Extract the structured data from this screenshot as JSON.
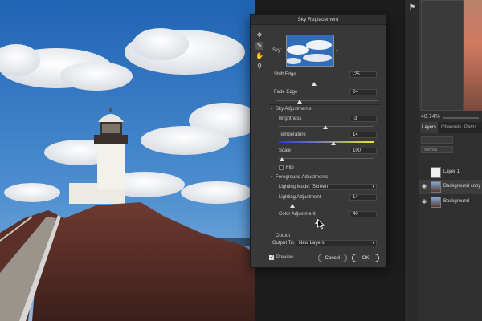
{
  "dialog": {
    "title": "Sky Replacement",
    "sky_label": "Sky:",
    "shift_edge": {
      "label": "Shift Edge",
      "value": "-25",
      "level": 0.38
    },
    "fade_edge": {
      "label": "Fade Edge",
      "value": "24",
      "level": 0.24
    },
    "sky_adjustments": {
      "heading": "Sky Adjustments",
      "brightness": {
        "label": "Brightness",
        "value": "-3",
        "level": 0.49
      },
      "temperature": {
        "label": "Temperature",
        "value": "14",
        "level": 0.57
      },
      "scale": {
        "label": "Scale",
        "value": "100",
        "level": 0.03
      },
      "flip_label": "Flip"
    },
    "foreground_adjustments": {
      "heading": "Foreground Adjustments",
      "lighting_mode_label": "Lighting Mode:",
      "lighting_mode_value": "Screen",
      "lighting_adjustment": {
        "label": "Lighting Adjustment",
        "value": "14",
        "level": 0.14
      },
      "color_adjustment": {
        "label": "Color Adjustment",
        "value": "40",
        "level": 0.4
      }
    },
    "output": {
      "heading": "Output",
      "output_to_label": "Output To:",
      "output_to_value": "New Layers"
    },
    "preview_label": "Preview",
    "cancel_label": "Cancel",
    "ok_label": "OK"
  },
  "right_panel": {
    "zoom": "48.74%",
    "tabs": [
      "Layers",
      "Channels",
      "Paths"
    ],
    "blend_mode": "Normal",
    "layers": [
      {
        "name": "Layer 1",
        "visible": false
      },
      {
        "name": "Background copy",
        "visible": true,
        "selected": true
      },
      {
        "name": "Background",
        "visible": true
      }
    ]
  },
  "colors": {
    "dialog_bg": "#383838",
    "accent_temperature_cool": "#2a3cd6",
    "accent_temperature_warm": "#f0e430"
  },
  "icons": [
    "move-icon",
    "sky-brush-icon",
    "hand-icon",
    "zoom-icon",
    "eye-icon",
    "checkmark-icon",
    "chevron-down-icon"
  ]
}
